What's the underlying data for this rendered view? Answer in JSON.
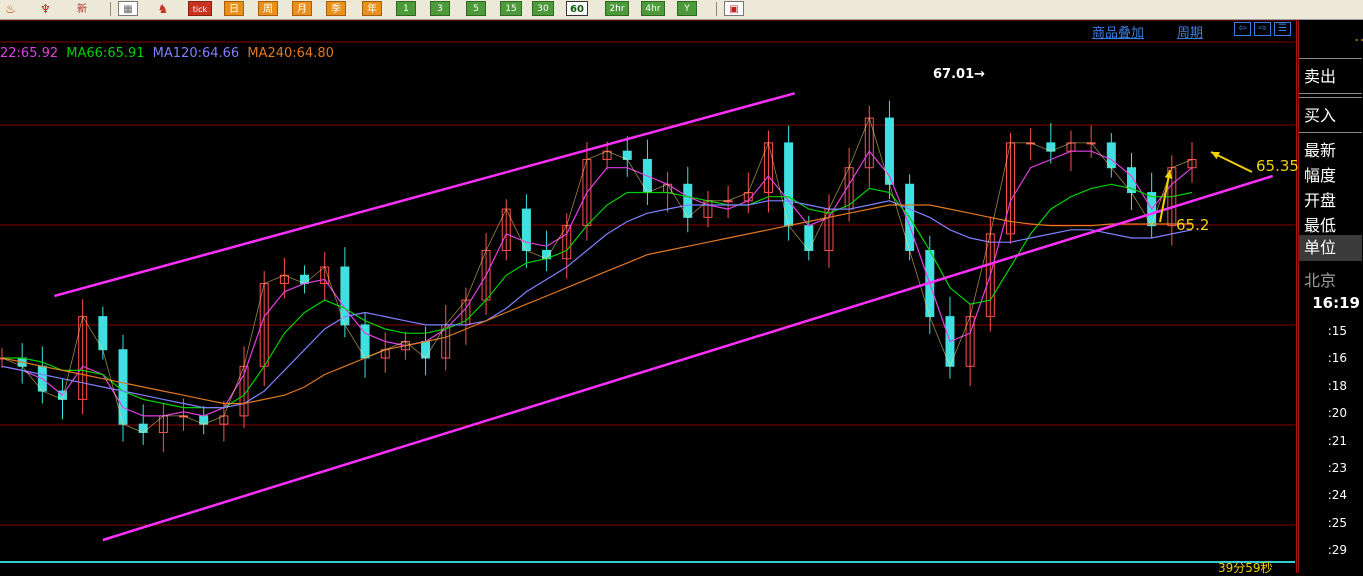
{
  "toolbar": {
    "buttons": [
      {
        "label": "新",
        "style": "plain"
      },
      {
        "label": "tick",
        "style": "red"
      },
      {
        "label": "日",
        "style": "orange"
      },
      {
        "label": "周",
        "style": "orange"
      },
      {
        "label": "月",
        "style": "orange"
      },
      {
        "label": "季",
        "style": "orange"
      },
      {
        "label": "年",
        "style": "orange"
      },
      {
        "label": "1",
        "style": "green"
      },
      {
        "label": "3",
        "style": "green"
      },
      {
        "label": "5",
        "style": "green"
      },
      {
        "label": "15",
        "style": "green"
      },
      {
        "label": "30",
        "style": "green"
      },
      {
        "label": "60",
        "style": "active"
      },
      {
        "label": "2hr",
        "style": "green"
      },
      {
        "label": "4hr",
        "style": "green"
      },
      {
        "label": "Y",
        "style": "green"
      }
    ]
  },
  "top_links": {
    "overlay": "商品叠加",
    "period": "周期"
  },
  "ma_legend": [
    {
      "text": "22:65.92",
      "color": "#e040e0"
    },
    {
      "text": "MA66:65.91",
      "color": "#00d000"
    },
    {
      "text": "MA120:64.66",
      "color": "#8080ff"
    },
    {
      "text": "MA240:64.80",
      "color": "#e07820"
    }
  ],
  "annotations": {
    "high_label": "67.01→",
    "price_6535": "65.35",
    "price_652": "65.2"
  },
  "right_panel": {
    "sell": "卖出",
    "buy": "买入",
    "fields": [
      "最新",
      "幅度",
      "开盘",
      "最低"
    ],
    "unit": "单位",
    "location": "北京",
    "current_time": "16:19",
    "time_rows": [
      ":15",
      ":16",
      ":18",
      ":20",
      ":21",
      ":23",
      ":24",
      ":25",
      ":29"
    ]
  },
  "countdown": "39分59秒",
  "colors": {
    "channel": "#ff30ff",
    "ma22": "#e040e0",
    "ma66": "#00d000",
    "ma120": "#8080ff",
    "ma240": "#e07820",
    "candle_up": "#ff5050",
    "candle_down": "#40e0e0",
    "grid": "#8a0000",
    "arrow": "#f0d000"
  },
  "chart_data": {
    "type": "line",
    "subtype": "candlestick",
    "ylim": [
      61.8,
      67.3
    ],
    "grid": true,
    "x": [
      0,
      1,
      2,
      3,
      4,
      5,
      6,
      7,
      8,
      9,
      10,
      11,
      12,
      13,
      14,
      15,
      16,
      17,
      18,
      19,
      20,
      21,
      22,
      23,
      24,
      25,
      26,
      27,
      28,
      29,
      30,
      31,
      32,
      33,
      34,
      35,
      36,
      37,
      38,
      39,
      40,
      41,
      42,
      43,
      44,
      45,
      46,
      47,
      48,
      49,
      50,
      51,
      52,
      53,
      54,
      55,
      56,
      57,
      58,
      59
    ],
    "series": [
      {
        "name": "price",
        "values": [
          64.0,
          63.9,
          63.6,
          63.5,
          64.5,
          64.1,
          63.2,
          63.1,
          63.3,
          63.3,
          63.2,
          63.3,
          63.9,
          64.9,
          65.0,
          64.9,
          65.1,
          64.4,
          64.0,
          64.1,
          64.2,
          64.0,
          64.4,
          64.7,
          65.3,
          65.8,
          65.3,
          65.2,
          65.6,
          66.4,
          66.5,
          66.4,
          66.0,
          66.1,
          65.7,
          65.9,
          65.9,
          66.0,
          66.6,
          65.6,
          65.3,
          65.8,
          66.3,
          66.9,
          66.1,
          65.3,
          64.5,
          63.9,
          64.5,
          65.5,
          66.6,
          66.6,
          66.5,
          66.6,
          66.6,
          66.3,
          66.0,
          65.6,
          66.3,
          66.4
        ]
      },
      {
        "name": "22",
        "values": [
          63.9,
          63.85,
          63.75,
          63.55,
          63.9,
          63.8,
          63.4,
          63.3,
          63.3,
          63.35,
          63.3,
          63.4,
          63.8,
          64.5,
          64.8,
          64.9,
          64.95,
          64.6,
          64.3,
          64.2,
          64.15,
          64.2,
          64.35,
          64.6,
          65.0,
          65.5,
          65.4,
          65.35,
          65.5,
          66.0,
          66.3,
          66.3,
          66.2,
          66.1,
          65.95,
          65.85,
          65.8,
          65.9,
          66.2,
          65.9,
          65.6,
          65.7,
          66.1,
          66.5,
          66.2,
          65.6,
          64.9,
          64.2,
          64.3,
          65.0,
          65.9,
          66.3,
          66.4,
          66.5,
          66.5,
          66.4,
          66.2,
          65.8,
          66.1,
          66.3
        ]
      },
      {
        "name": "MA66",
        "values": [
          64.0,
          64.0,
          63.95,
          63.85,
          63.85,
          63.8,
          63.6,
          63.5,
          63.45,
          63.4,
          63.4,
          63.4,
          63.55,
          63.9,
          64.3,
          64.55,
          64.7,
          64.6,
          64.45,
          64.35,
          64.3,
          64.3,
          64.35,
          64.45,
          64.7,
          65.0,
          65.15,
          65.2,
          65.3,
          65.6,
          65.85,
          66.0,
          66.0,
          66.0,
          65.95,
          65.9,
          65.85,
          65.85,
          65.95,
          65.95,
          65.8,
          65.75,
          65.85,
          66.05,
          66.0,
          65.7,
          65.3,
          64.85,
          64.65,
          64.7,
          65.1,
          65.5,
          65.8,
          65.95,
          66.05,
          66.1,
          66.05,
          65.95,
          65.95,
          66.0
        ]
      },
      {
        "name": "MA120",
        "values": [
          63.9,
          63.85,
          63.8,
          63.75,
          63.7,
          63.65,
          63.6,
          63.55,
          63.5,
          63.45,
          63.4,
          63.4,
          63.45,
          63.6,
          63.85,
          64.1,
          64.35,
          64.5,
          64.55,
          64.5,
          64.45,
          64.4,
          64.4,
          64.4,
          64.45,
          64.6,
          64.8,
          64.95,
          65.1,
          65.3,
          65.5,
          65.65,
          65.75,
          65.8,
          65.85,
          65.85,
          65.85,
          65.85,
          65.9,
          65.9,
          65.85,
          65.8,
          65.8,
          65.85,
          65.9,
          65.8,
          65.7,
          65.55,
          65.45,
          65.4,
          65.4,
          65.45,
          65.5,
          65.55,
          65.55,
          65.5,
          65.45,
          65.45,
          65.5,
          65.55
        ]
      },
      {
        "name": "MA240",
        "values": [
          64.0,
          63.95,
          63.9,
          63.85,
          63.8,
          63.75,
          63.7,
          63.65,
          63.6,
          63.55,
          63.5,
          63.45,
          63.45,
          63.5,
          63.55,
          63.65,
          63.8,
          63.9,
          64.0,
          64.1,
          64.15,
          64.2,
          64.25,
          64.35,
          64.45,
          64.55,
          64.65,
          64.75,
          64.85,
          64.95,
          65.05,
          65.15,
          65.25,
          65.3,
          65.35,
          65.4,
          65.45,
          65.5,
          65.55,
          65.6,
          65.65,
          65.7,
          65.75,
          65.8,
          65.85,
          65.85,
          65.85,
          65.8,
          65.75,
          65.7,
          65.65,
          65.62,
          65.6,
          65.6,
          65.6,
          65.62,
          65.62,
          65.62,
          65.62,
          65.62
        ]
      }
    ],
    "channel_lines": [
      {
        "name": "upper",
        "points": [
          [
            2.6,
            64.75
          ],
          [
            39.3,
            67.2
          ]
        ]
      },
      {
        "name": "lower",
        "points": [
          [
            5.0,
            61.8
          ],
          [
            63.0,
            66.2
          ]
        ]
      }
    ]
  }
}
